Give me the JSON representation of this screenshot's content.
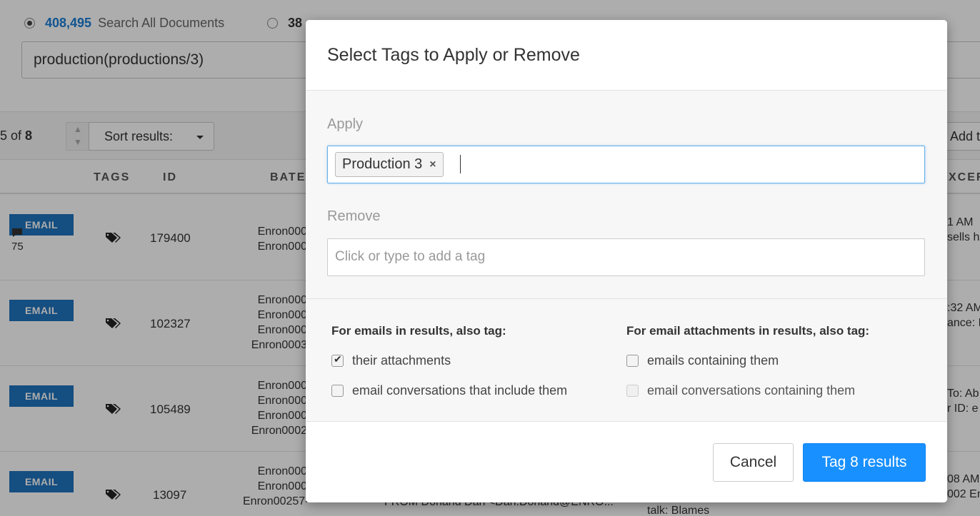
{
  "scope": {
    "all_count": "408,495",
    "all_label": "Search All Documents",
    "second_count": "38"
  },
  "query": "production(productions/3)",
  "toolbar": {
    "pager_prefix": "5 of ",
    "pager_total": "8",
    "sort_label": "Sort results:",
    "add_label": "Add t"
  },
  "table": {
    "headers": [
      "TAGS",
      "ID",
      "BATES",
      "XCER"
    ],
    "rows": [
      {
        "badge": "EMAIL",
        "comments": "75",
        "id": "179400",
        "bates": [
          "Enron000",
          "Enron000"
        ],
        "excerpt": [
          "1 AM",
          "sells hi"
        ]
      },
      {
        "badge": "EMAIL",
        "id": "102327",
        "bates": [
          "Enron000",
          "Enron000",
          "Enron000",
          "Enron0003"
        ],
        "excerpt": [
          ":32 AM",
          "ance: L"
        ]
      },
      {
        "badge": "EMAIL",
        "id": "105489",
        "bates": [
          "Enron000",
          "Enron000",
          "Enron000",
          "Enron0002"
        ],
        "excerpt": [
          "To: Ab",
          "r ID: e"
        ]
      },
      {
        "badge": "EMAIL",
        "id": "13097",
        "bates": [
          "Enron000",
          "Enron000",
          "Enron00257-"
        ],
        "excerpt": [
          "08 AM",
          "002 En"
        ],
        "from": "FROM Donand Dan <Dan.Donand@ENRO...",
        "talk": "talk: Blames"
      }
    ]
  },
  "modal": {
    "title": "Select Tags to Apply or Remove",
    "apply_label": "Apply",
    "apply_chip": "Production 3",
    "chip_remove": "×",
    "remove_label": "Remove",
    "remove_placeholder": "Click or type to add a tag",
    "emails_heading": "For emails in results, also tag:",
    "emails_opts": [
      {
        "label": "their attachments",
        "checked": true
      },
      {
        "label": "email conversations that include them",
        "checked": false
      }
    ],
    "attach_heading": "For email attachments in results, also tag:",
    "attach_opts": [
      {
        "label": "emails containing them",
        "checked": false
      },
      {
        "label": "email conversations containing them",
        "checked": false,
        "disabled": true
      }
    ],
    "cancel_label": "Cancel",
    "submit_label": "Tag 8 results"
  },
  "colors": {
    "primary": "#1990ff",
    "badge": "#1f74bd",
    "link": "#1a7ed6"
  }
}
